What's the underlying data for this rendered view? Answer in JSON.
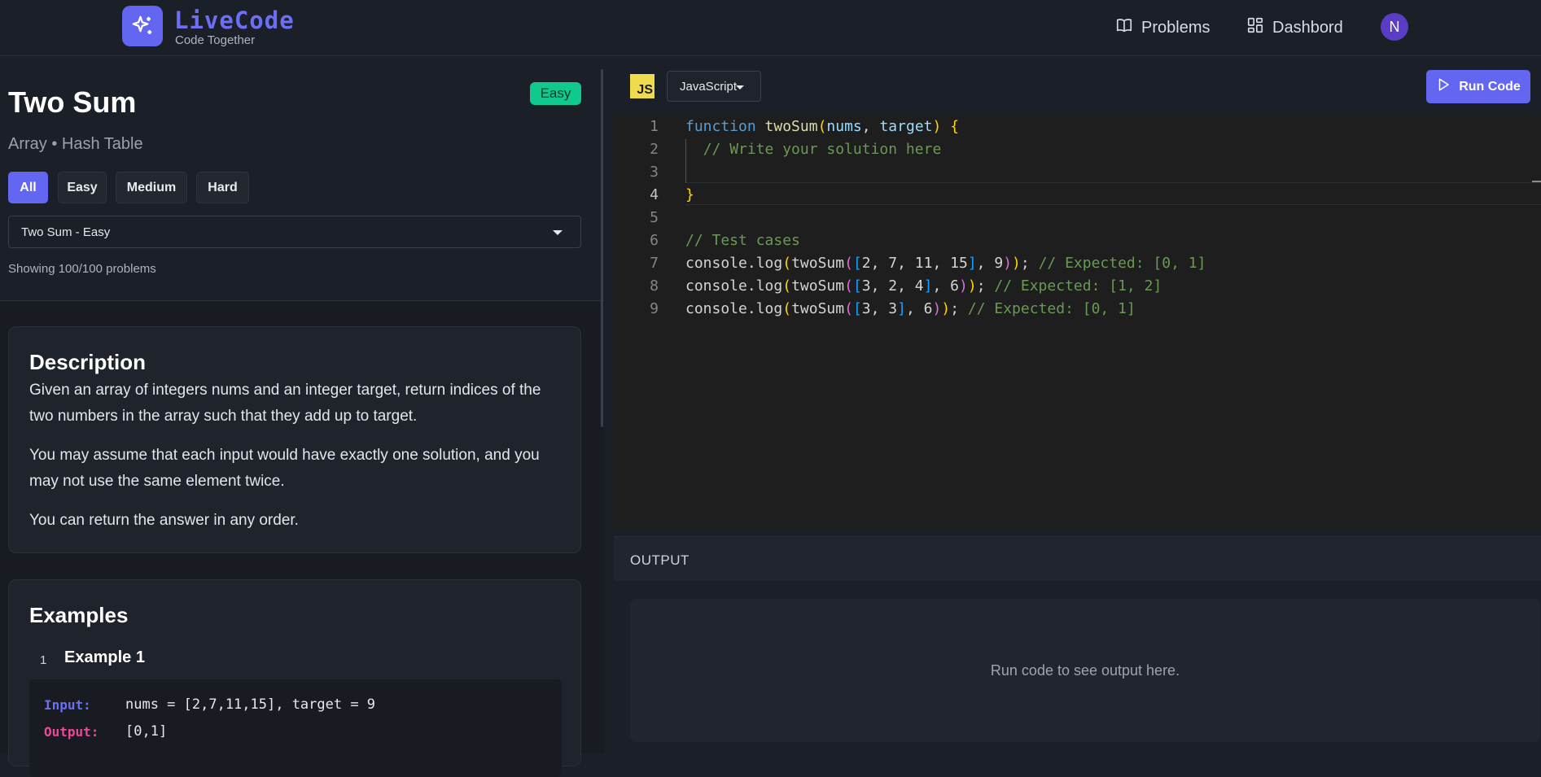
{
  "header": {
    "brand_title": "LiveCode",
    "brand_subtitle": "Code Together",
    "nav": [
      {
        "label": "Problems",
        "icon": "book-icon"
      },
      {
        "label": "Dashbord",
        "icon": "grid-icon"
      }
    ],
    "avatar_initial": "N"
  },
  "problem": {
    "title": "Two Sum",
    "difficulty": "Easy",
    "tags": "Array • Hash Table",
    "filters": [
      "All",
      "Easy",
      "Medium",
      "Hard"
    ],
    "active_filter": "All",
    "selected_problem": "Two Sum - Easy",
    "showing": "Showing 100/100 problems"
  },
  "description": {
    "heading": "Description",
    "paragraphs": [
      "Given an array of integers nums and an integer target, return indices of the two numbers in the array such that they add up to target.",
      "You may assume that each input would have exactly one solution, and you may not use the same element twice.",
      "You can return the answer in any order."
    ]
  },
  "examples": {
    "heading": "Examples",
    "items": [
      {
        "number": "1",
        "title": "Example 1",
        "input_label": "Input:",
        "input": "nums = [2,7,11,15], target = 9",
        "output_label": "Output:",
        "output": "[0,1]"
      }
    ]
  },
  "editor": {
    "language_badge": "JS",
    "language": "JavaScript",
    "run_label": "Run Code",
    "current_line": 4,
    "line_numbers": [
      "1",
      "2",
      "3",
      "4",
      "5",
      "6",
      "7",
      "8",
      "9"
    ]
  },
  "output": {
    "title": "OUTPUT",
    "placeholder": "Run code to see output here."
  },
  "colors": {
    "accent": "#6366f1",
    "easy": "#10c98c",
    "input_label": "#6c6ff5",
    "output_label": "#ec4899"
  }
}
